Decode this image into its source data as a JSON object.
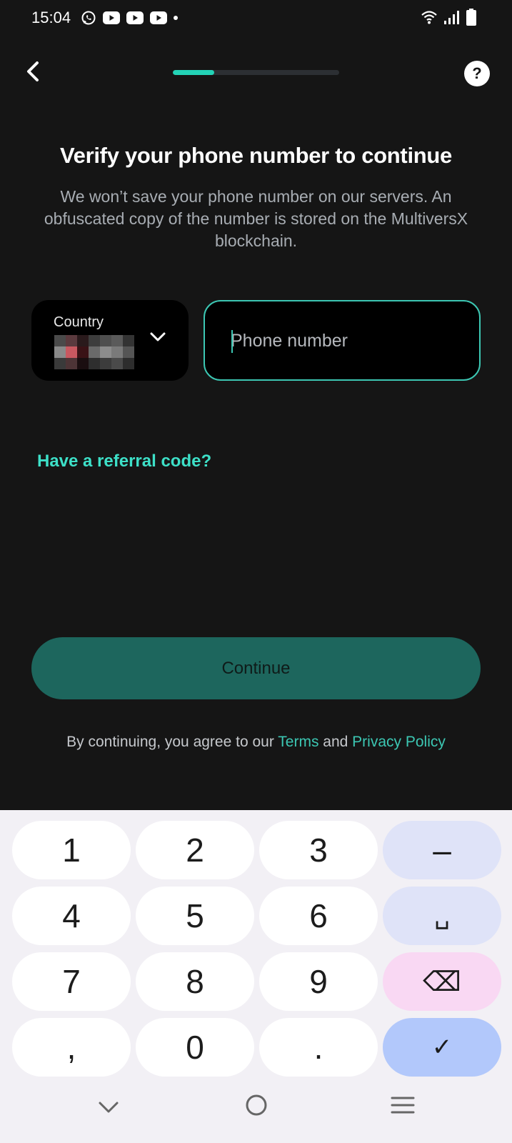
{
  "status_bar": {
    "time": "15:04",
    "left_icons": [
      "whatsapp-icon",
      "youtube-icon",
      "youtube-icon",
      "youtube-icon",
      "dot-icon"
    ],
    "right_icons": [
      "wifi-icon",
      "signal-icon",
      "battery-icon"
    ]
  },
  "header": {
    "progress_fraction": 0.25,
    "back_icon": "chevron-left-icon",
    "help_icon": "question-icon"
  },
  "title": "Verify your phone number to continue",
  "subtitle": "We won’t save your phone number on our servers. An obfuscated copy of the number is stored on the MultiversX blockchain.",
  "country": {
    "label": "Country",
    "flag_icon": "pixelated-flag-icon"
  },
  "phone": {
    "placeholder": "Phone number",
    "value": ""
  },
  "referral_link": "Have a referral code?",
  "continue_button": "Continue",
  "agreement": {
    "prefix": "By continuing, you agree to our ",
    "terms": "Terms",
    "middle": " and ",
    "privacy": "Privacy Policy"
  },
  "keyboard": {
    "keys": [
      "1",
      "2",
      "3",
      "–",
      "4",
      "5",
      "6",
      "␣",
      "7",
      "8",
      "9",
      "⌫",
      ",",
      "0",
      ".",
      "✓"
    ]
  },
  "colors": {
    "accent": "#3cc7b3",
    "background": "#151515",
    "continue_bg": "#1d665d"
  }
}
